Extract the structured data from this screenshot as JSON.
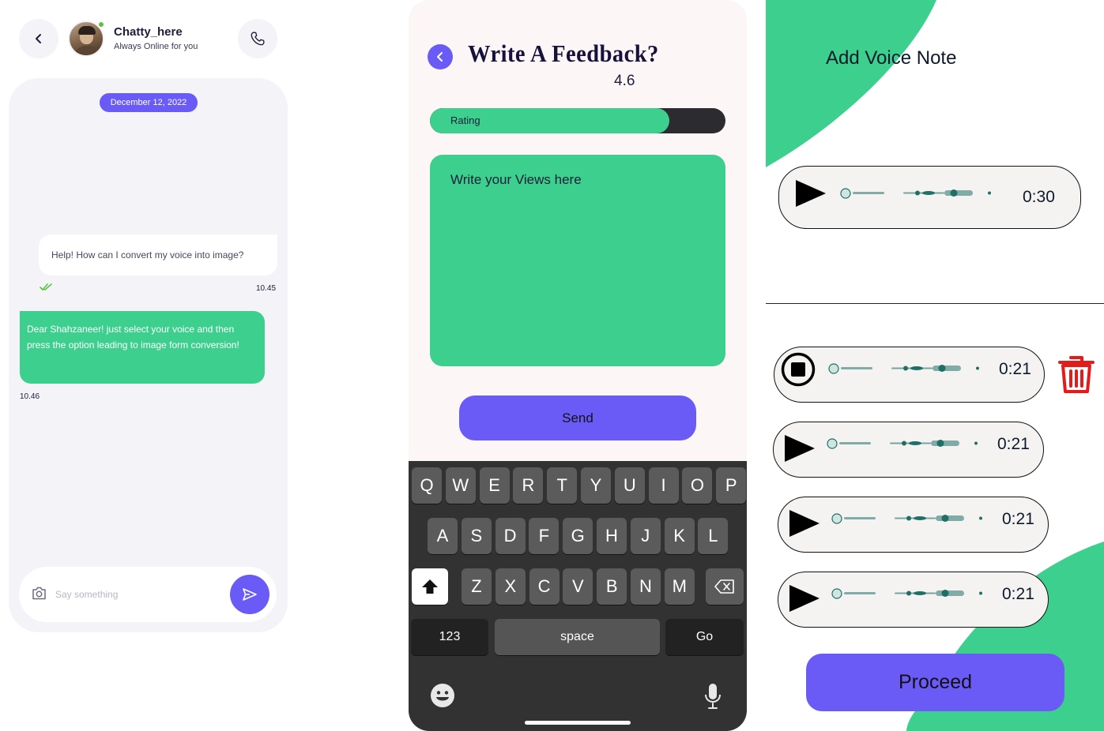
{
  "chat": {
    "contact_name": "Chatty_here",
    "contact_status": "Always Online for you",
    "date_label": "December 12, 2022",
    "messages": [
      {
        "text": "Help! How can I convert my voice into image?",
        "time": "10.45"
      },
      {
        "text": "Dear Shahzaneer! just select your voice and then press the option leading to image form conversion!",
        "time": "10.46"
      }
    ],
    "input_placeholder": "Say something"
  },
  "feedback": {
    "title": "Write A Feedback?",
    "rating_value": "4.6",
    "rating_label": "Rating",
    "rating_fraction": 0.81,
    "views_placeholder": "Write your Views here",
    "send_label": "Send"
  },
  "keyboard": {
    "row1": [
      "Q",
      "W",
      "E",
      "R",
      "T",
      "Y",
      "U",
      "I",
      "O",
      "P"
    ],
    "row2": [
      "A",
      "S",
      "D",
      "F",
      "G",
      "H",
      "J",
      "K",
      "L"
    ],
    "row3": [
      "Z",
      "X",
      "C",
      "V",
      "B",
      "N",
      "M"
    ],
    "numbers_label": "123",
    "space_label": "space",
    "go_label": "Go"
  },
  "voice": {
    "title": "Add Voice Note",
    "current_note_duration": "0:30",
    "notes": [
      {
        "duration": "0:21",
        "state": "playing"
      },
      {
        "duration": "0:21",
        "state": "paused"
      },
      {
        "duration": "0:21",
        "state": "paused"
      },
      {
        "duration": "0:21",
        "state": "paused"
      }
    ],
    "proceed_label": "Proceed"
  },
  "colors": {
    "accent_purple": "#6b5bf6",
    "accent_green": "#3ccf8e",
    "delete_red": "#e21b1b",
    "keyboard_bg": "#323232"
  }
}
